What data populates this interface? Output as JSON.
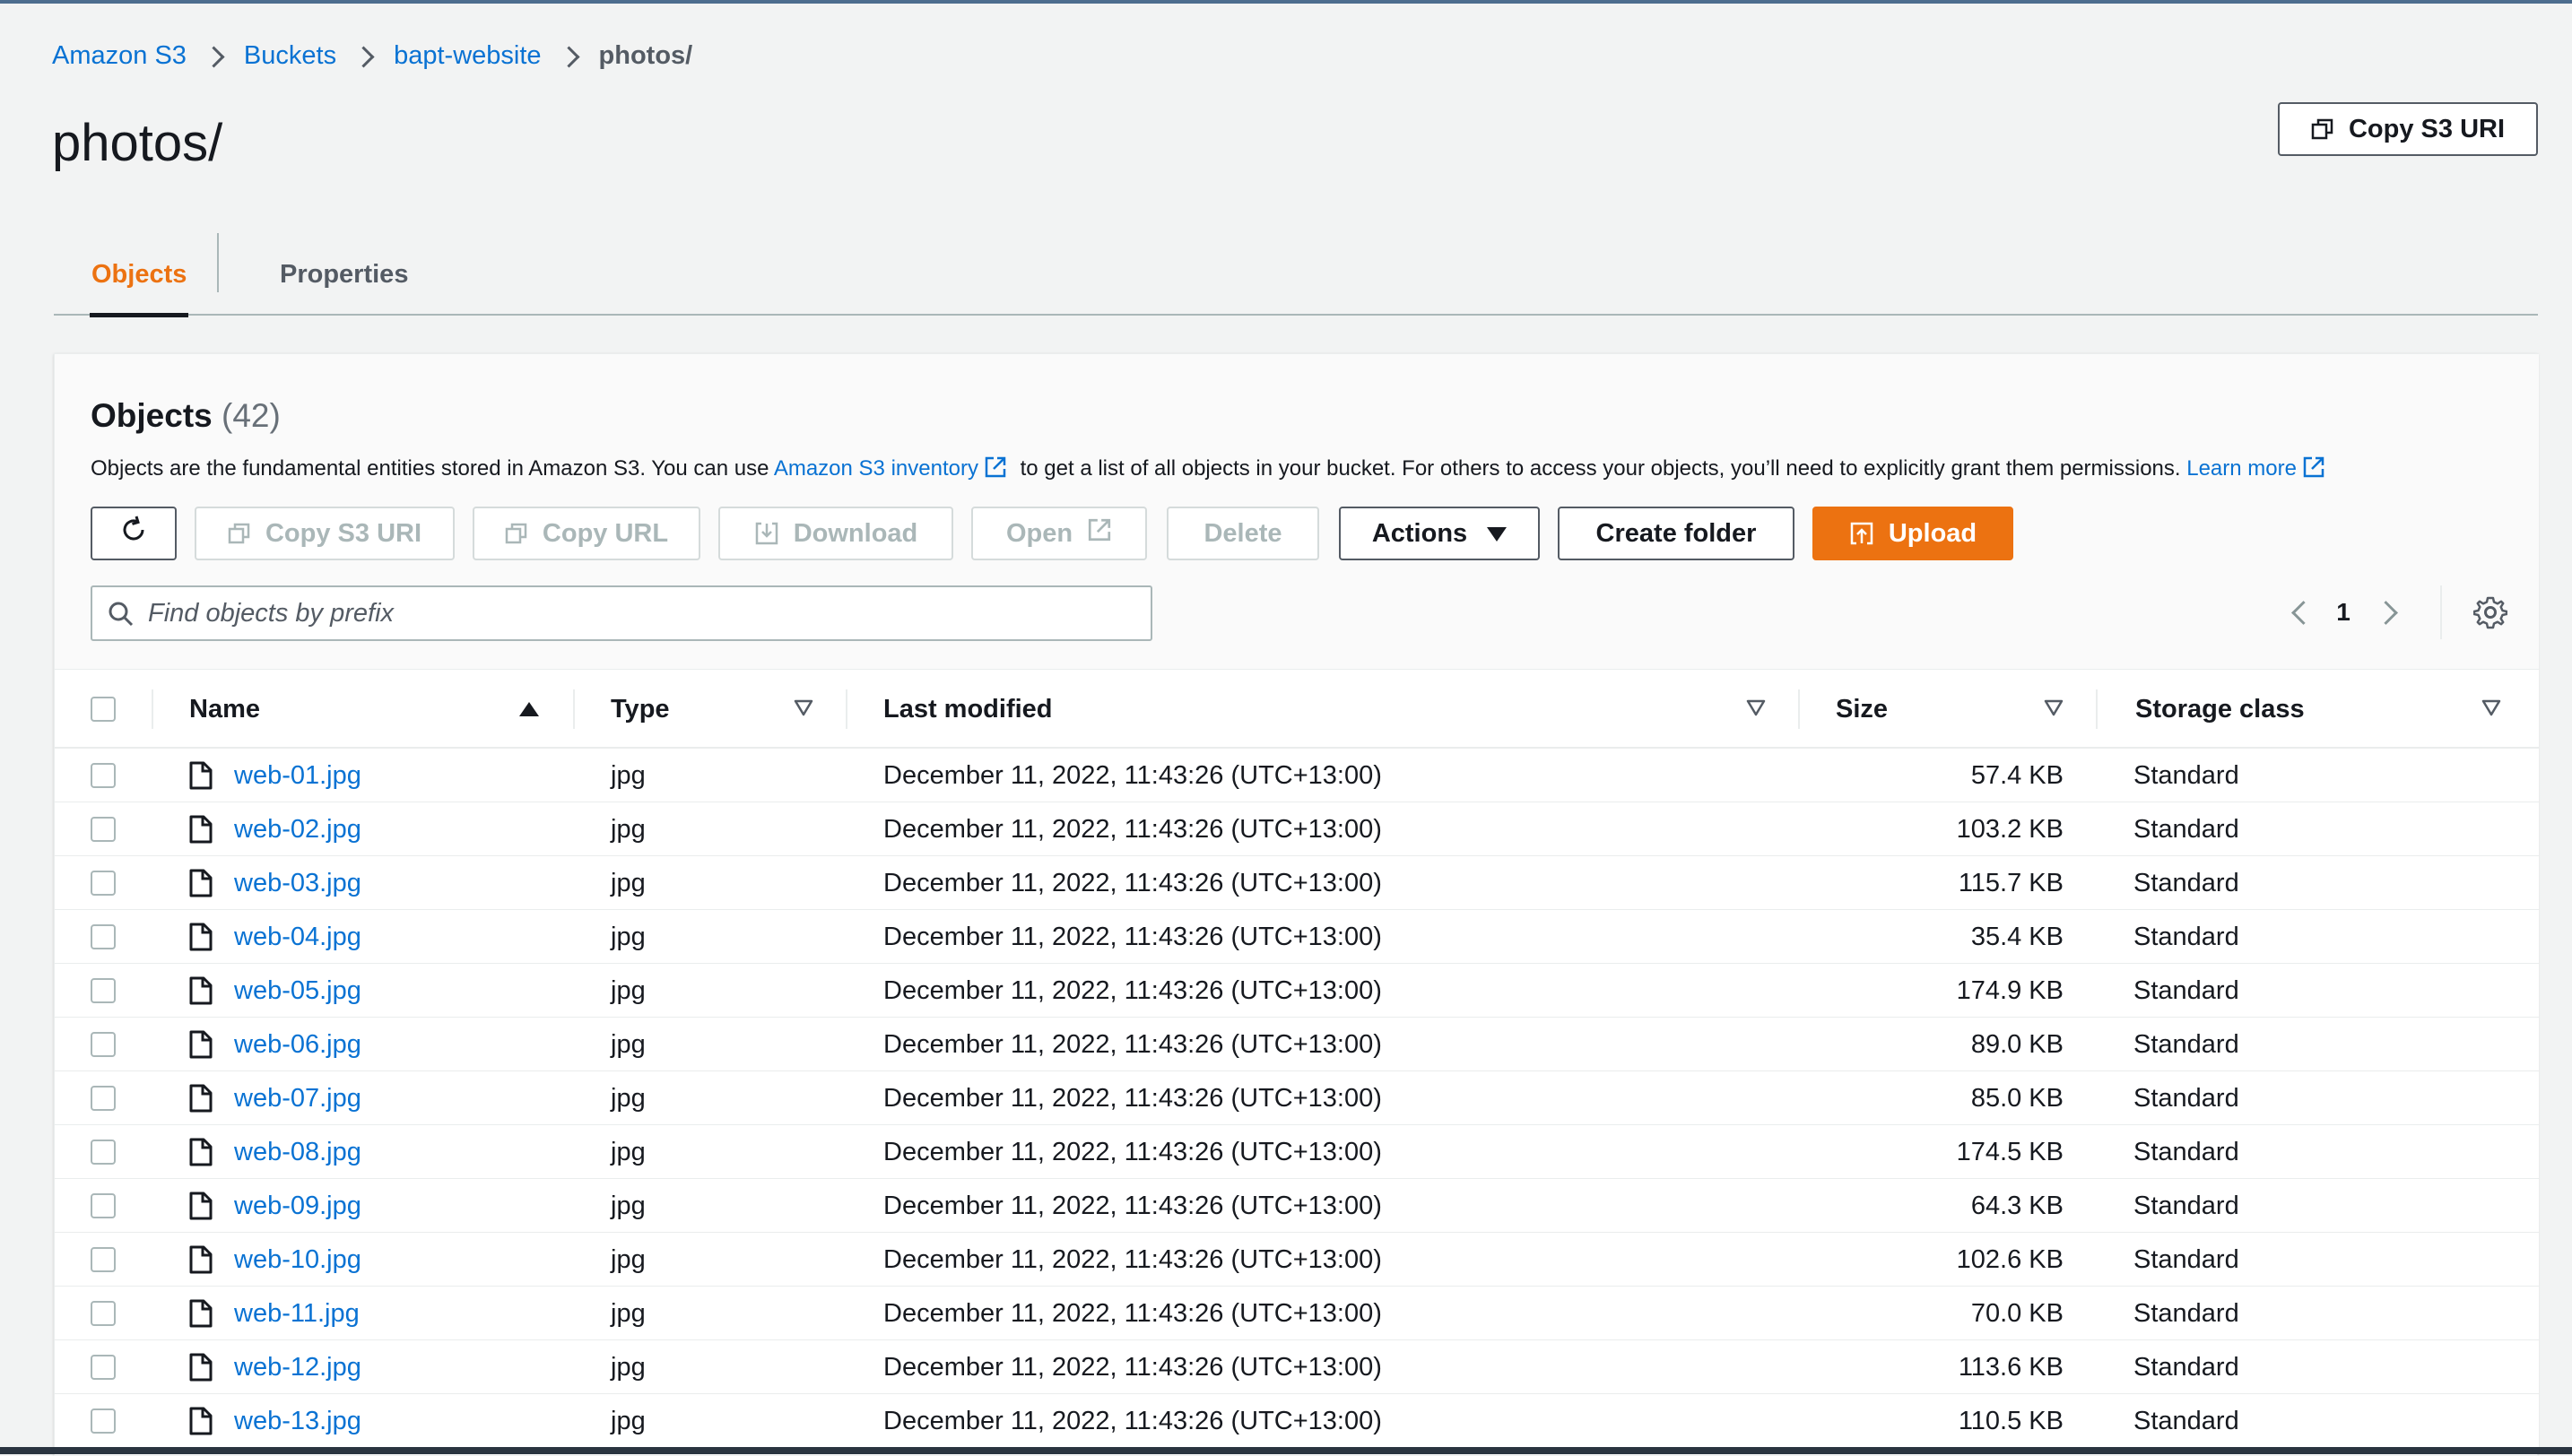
{
  "breadcrumb": [
    "Amazon S3",
    "Buckets",
    "bapt-website",
    "photos/"
  ],
  "page_title": "photos/",
  "header_button": {
    "label": "Copy S3 URI",
    "icon": "copy-icon"
  },
  "tabs": [
    {
      "label": "Objects",
      "active": true
    },
    {
      "label": "Properties",
      "active": false
    }
  ],
  "objects_panel": {
    "title": "Objects",
    "count": "(42)",
    "desc_1": "Objects are the fundamental entities stored in Amazon S3. You can use ",
    "desc_link_1": "Amazon S3 inventory",
    "desc_2": " to get a list of all objects in your bucket. For others to access your objects, you’ll need to explicitly grant them permissions. ",
    "desc_link_2": "Learn more",
    "toolbar": {
      "refresh": "refresh-icon",
      "copy_s3_uri": "Copy S3 URI",
      "copy_url": "Copy URL",
      "download": "Download",
      "open": "Open",
      "delete": "Delete",
      "actions": "Actions",
      "create_folder": "Create folder",
      "upload": "Upload"
    },
    "search": {
      "placeholder": "Find objects by prefix",
      "value": ""
    },
    "pagination": {
      "current_page": "1"
    }
  },
  "table": {
    "columns": [
      "Name",
      "Type",
      "Last modified",
      "Size",
      "Storage class"
    ],
    "sort": {
      "column": "Name",
      "direction": "ascending"
    },
    "rows": [
      {
        "name": "web-01.jpg",
        "type": "jpg",
        "modified": "December 11, 2022, 11:43:26 (UTC+13:00)",
        "size": "57.4 KB",
        "storage": "Standard"
      },
      {
        "name": "web-02.jpg",
        "type": "jpg",
        "modified": "December 11, 2022, 11:43:26 (UTC+13:00)",
        "size": "103.2 KB",
        "storage": "Standard"
      },
      {
        "name": "web-03.jpg",
        "type": "jpg",
        "modified": "December 11, 2022, 11:43:26 (UTC+13:00)",
        "size": "115.7 KB",
        "storage": "Standard"
      },
      {
        "name": "web-04.jpg",
        "type": "jpg",
        "modified": "December 11, 2022, 11:43:26 (UTC+13:00)",
        "size": "35.4 KB",
        "storage": "Standard"
      },
      {
        "name": "web-05.jpg",
        "type": "jpg",
        "modified": "December 11, 2022, 11:43:26 (UTC+13:00)",
        "size": "174.9 KB",
        "storage": "Standard"
      },
      {
        "name": "web-06.jpg",
        "type": "jpg",
        "modified": "December 11, 2022, 11:43:26 (UTC+13:00)",
        "size": "89.0 KB",
        "storage": "Standard"
      },
      {
        "name": "web-07.jpg",
        "type": "jpg",
        "modified": "December 11, 2022, 11:43:26 (UTC+13:00)",
        "size": "85.0 KB",
        "storage": "Standard"
      },
      {
        "name": "web-08.jpg",
        "type": "jpg",
        "modified": "December 11, 2022, 11:43:26 (UTC+13:00)",
        "size": "174.5 KB",
        "storage": "Standard"
      },
      {
        "name": "web-09.jpg",
        "type": "jpg",
        "modified": "December 11, 2022, 11:43:26 (UTC+13:00)",
        "size": "64.3 KB",
        "storage": "Standard"
      },
      {
        "name": "web-10.jpg",
        "type": "jpg",
        "modified": "December 11, 2022, 11:43:26 (UTC+13:00)",
        "size": "102.6 KB",
        "storage": "Standard"
      },
      {
        "name": "web-11.jpg",
        "type": "jpg",
        "modified": "December 11, 2022, 11:43:26 (UTC+13:00)",
        "size": "70.0 KB",
        "storage": "Standard"
      },
      {
        "name": "web-12.jpg",
        "type": "jpg",
        "modified": "December 11, 2022, 11:43:26 (UTC+13:00)",
        "size": "113.6 KB",
        "storage": "Standard"
      },
      {
        "name": "web-13.jpg",
        "type": "jpg",
        "modified": "December 11, 2022, 11:43:26 (UTC+13:00)",
        "size": "110.5 KB",
        "storage": "Standard"
      }
    ]
  },
  "colors": {
    "link": "#0972d3",
    "accent": "#ec7211",
    "background": "#f2f3f3",
    "text": "#16191f"
  }
}
